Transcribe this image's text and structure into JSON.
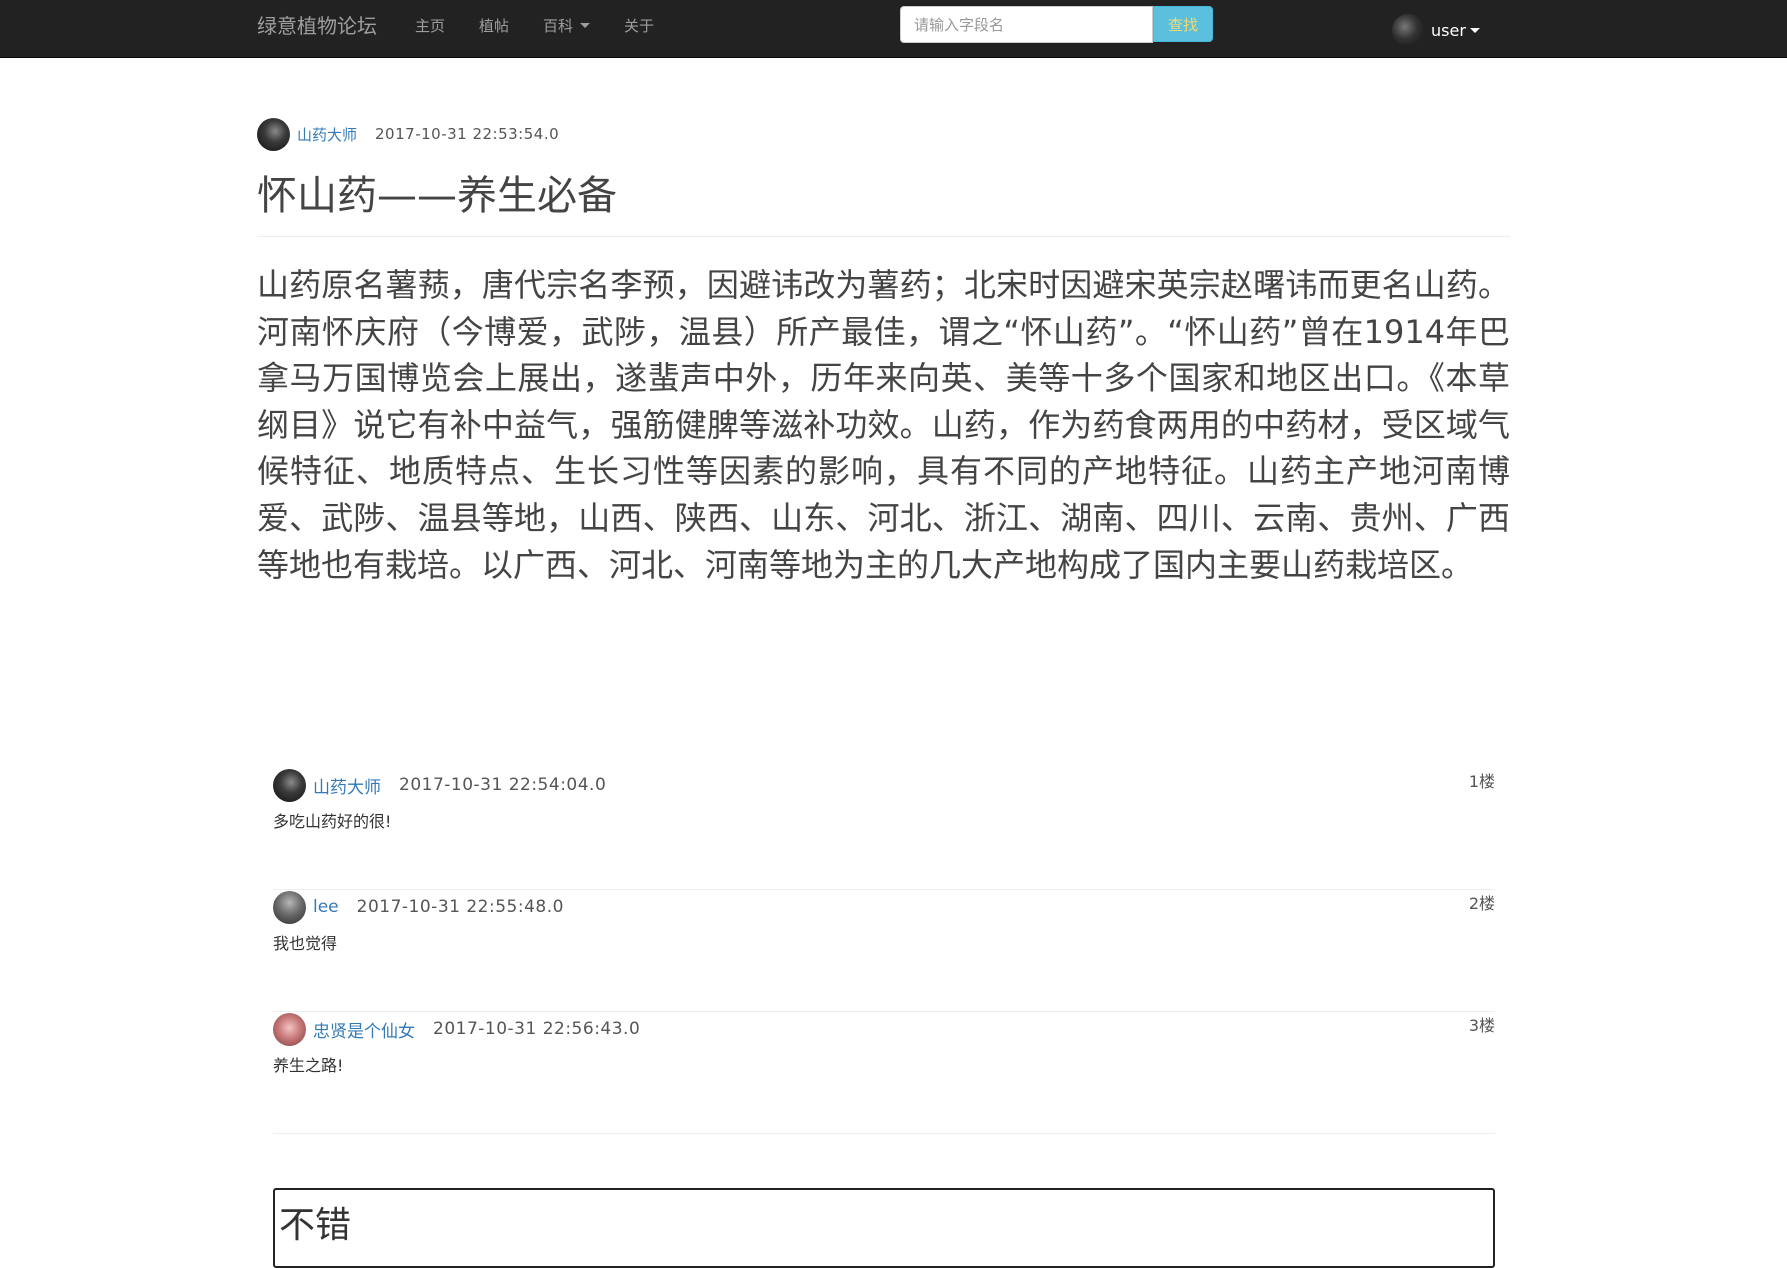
{
  "navbar": {
    "brand": "绿意植物论坛",
    "links": [
      {
        "label": "主页"
      },
      {
        "label": "植帖"
      },
      {
        "label": "百科",
        "dropdown": true
      },
      {
        "label": "关于"
      }
    ],
    "search": {
      "placeholder": "请输入字段名",
      "button_label": "查找"
    },
    "user": {
      "name": "user",
      "avatar_icon": "user-avatar-icon"
    }
  },
  "post": {
    "author": "山药大师",
    "time": "2017-10-31 22:53:54.0",
    "title": "怀山药——养生必备",
    "body": "山药原名薯蓣，唐代宗名李预，因避讳改为薯药；北宋时因避宋英宗赵曙讳而更名山药。河南怀庆府（今博爱，武陟，温县）所产最佳，谓之“怀山药”。“怀山药”曾在1914年巴拿马万国博览会上展出，遂蜚声中外，历年来向英、美等十多个国家和地区出口。《本草纲目》说它有补中益气，强筋健脾等滋补功效。山药，作为药食两用的中药材，受区域气候特征、地质特点、生长习性等因素的影响，具有不同的产地特征。山药主产地河南博爱、武陟、温县等地，山西、陕西、山东、河北、浙江、湖南、四川、云南、贵州、广西等地也有栽培。以广西、河北、河南等地为主的几大产地构成了国内主要山药栽培区。"
  },
  "comments": [
    {
      "author": "山药大师",
      "time": "2017-10-31 22:54:04.0",
      "floor": "1楼",
      "text": "多吃山药好的很!"
    },
    {
      "author": "lee",
      "time": "2017-10-31 22:55:48.0",
      "floor": "2楼",
      "text": "我也觉得"
    },
    {
      "author": "忠贤是个仙女",
      "time": "2017-10-31 22:56:43.0",
      "floor": "3楼",
      "text": "养生之路!"
    }
  ],
  "reply": {
    "value": "不错"
  },
  "colors": {
    "navbar_bg": "#222222",
    "link": "#337ab7",
    "search_button": "#5bc0de"
  }
}
